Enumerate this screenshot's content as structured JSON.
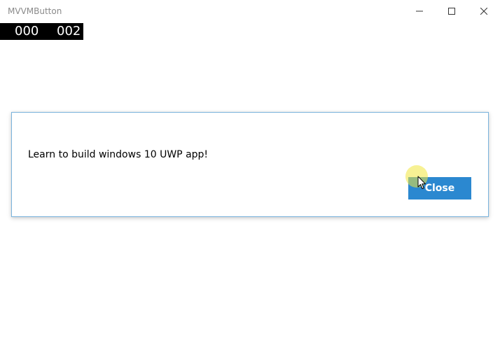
{
  "window": {
    "title": "MVVMButton",
    "controls": {
      "minimize_icon": "minimize-icon",
      "maximize_icon": "maximize-icon",
      "close_icon": "close-icon"
    }
  },
  "counter": {
    "left": "000",
    "right": "002"
  },
  "dialog": {
    "message": "Learn to build windows 10 UWP app!",
    "close_label": "Close",
    "border_color": "#7ab4dd",
    "button_color": "#2b88d0"
  },
  "cursor": {
    "icon": "mouse-pointer-icon",
    "highlight_color": "#f0e63c"
  }
}
